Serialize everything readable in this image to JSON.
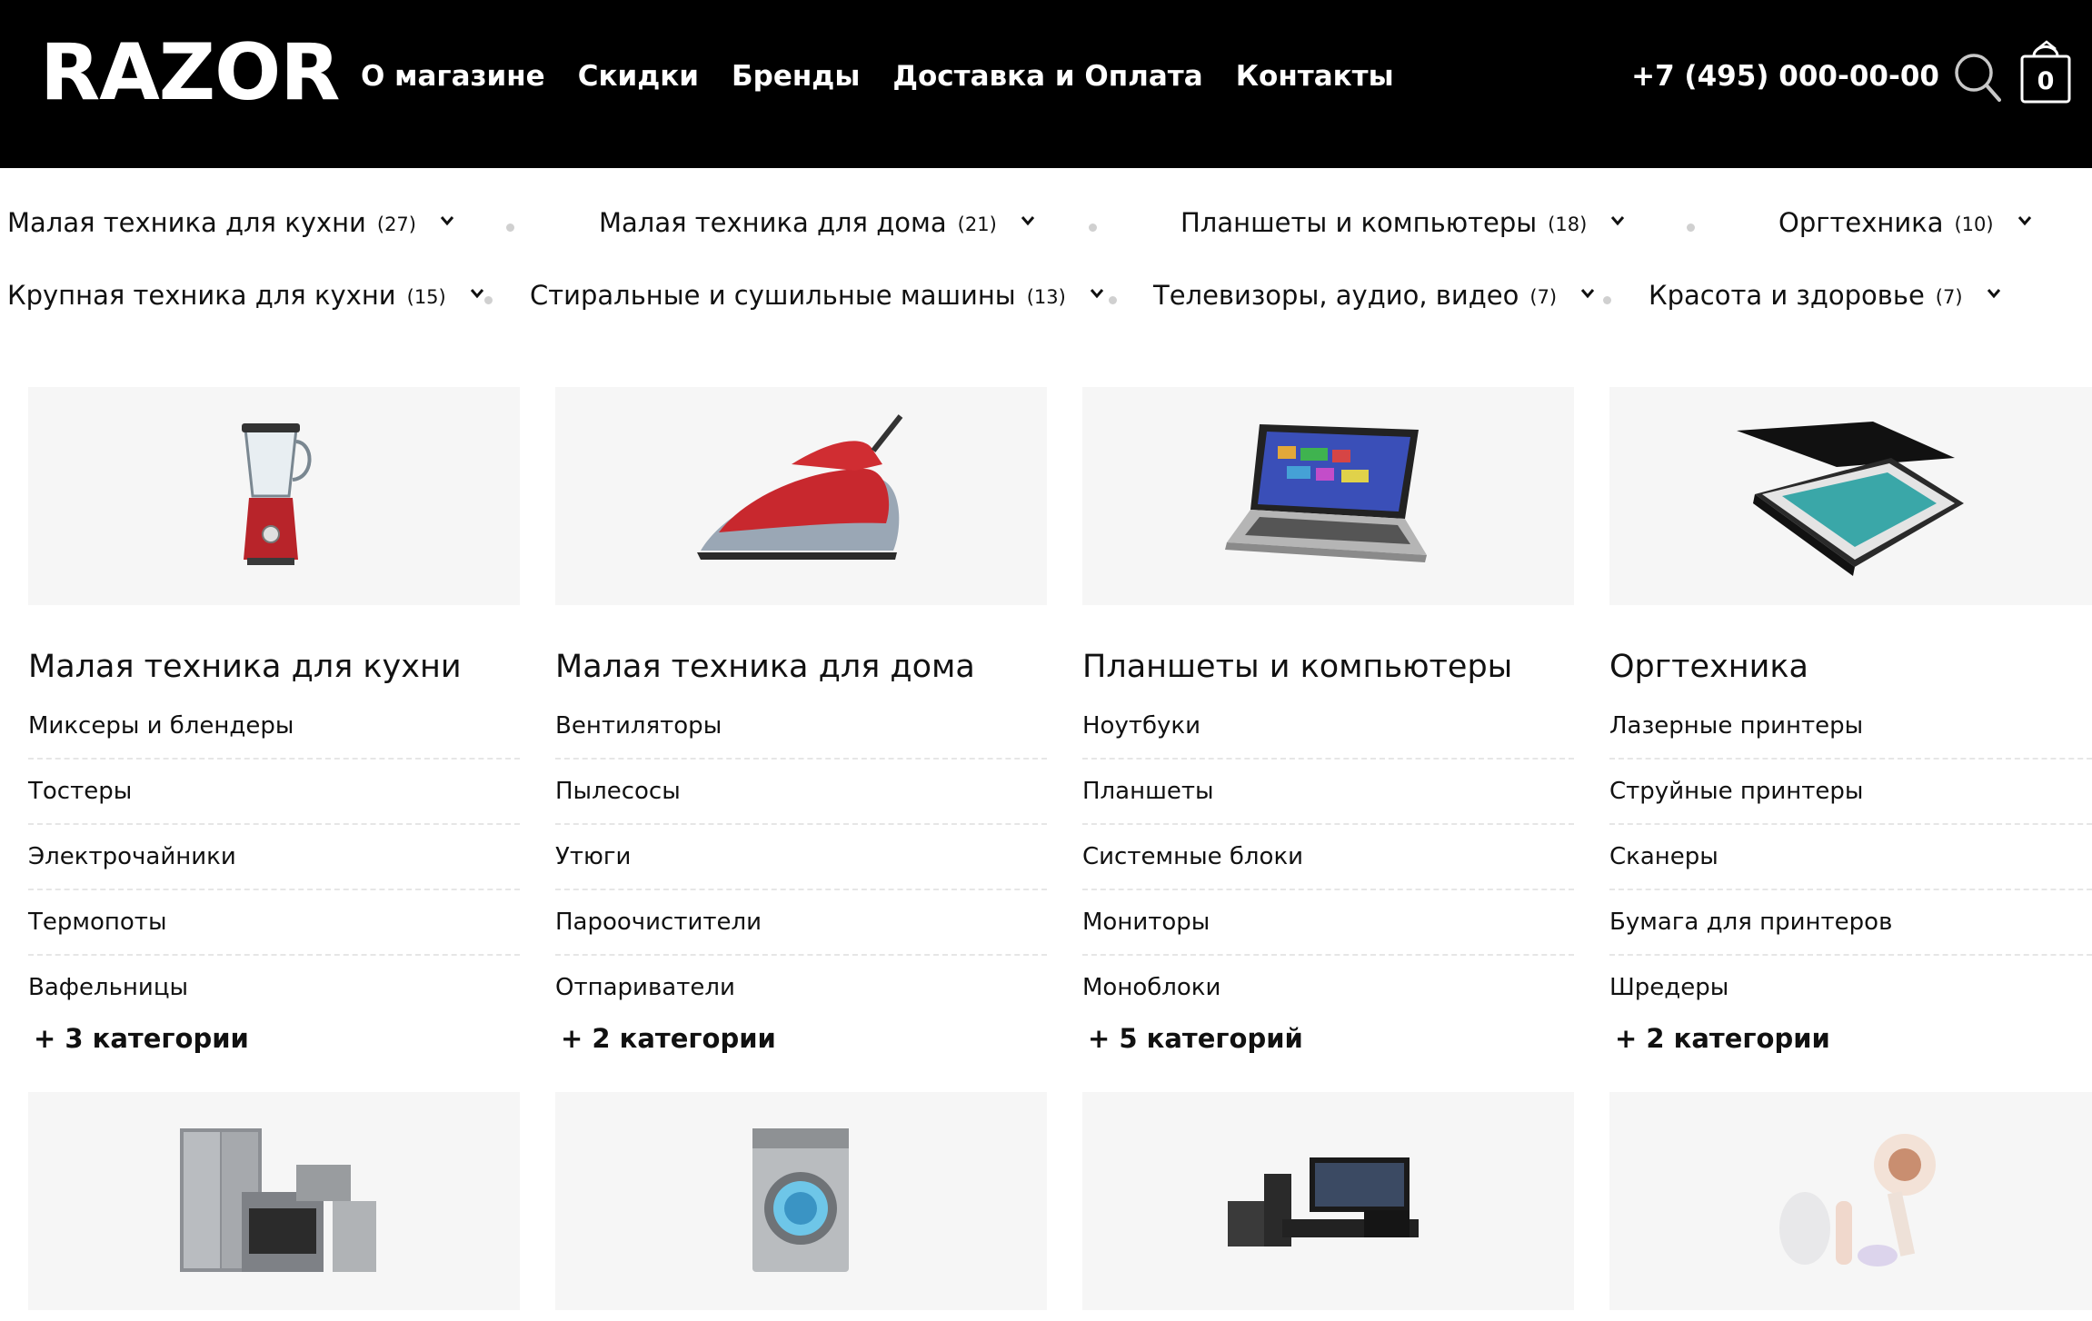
{
  "header": {
    "logo": "RAZOR",
    "nav": [
      "О магазине",
      "Скидки",
      "Бренды",
      "Доставка и Оплата",
      "Контакты"
    ],
    "phone": "+7 (495) 000-00-00",
    "cart_count": "0"
  },
  "filters": [
    {
      "label": "Малая техника для кухни",
      "count": "(27)"
    },
    {
      "label": "Малая техника для дома",
      "count": "(21)"
    },
    {
      "label": "Планшеты и компьютеры",
      "count": "(18)"
    },
    {
      "label": "Оргтехника",
      "count": "(10)"
    },
    {
      "label": "Крупная техника для кухни",
      "count": "(15)"
    },
    {
      "label": "Стиральные и сушильные машины",
      "count": "(13)"
    },
    {
      "label": "Телевизоры, аудио, видео",
      "count": "(7)"
    },
    {
      "label": "Красота и здоровье",
      "count": "(7)"
    }
  ],
  "cards": [
    {
      "title": "Малая техника для кухни",
      "items": [
        "Миксеры и блендеры",
        "Тостеры",
        "Электрочайники",
        "Термопоты",
        "Вафельницы"
      ],
      "more": "+ 3 категории",
      "image": "blender-icon"
    },
    {
      "title": "Малая техника для дома",
      "items": [
        "Вентиляторы",
        "Пылесосы",
        "Утюги",
        "Пароочистители",
        "Отпариватели"
      ],
      "more": "+ 2 категории",
      "image": "iron-icon"
    },
    {
      "title": "Планшеты и компьютеры",
      "items": [
        "Ноутбуки",
        "Планшеты",
        "Системные блоки",
        "Мониторы",
        "Моноблоки"
      ],
      "more": "+ 5 категорий",
      "image": "laptop-icon"
    },
    {
      "title": "Оргтехника",
      "items": [
        "Лазерные принтеры",
        "Струйные принтеры",
        "Сканеры",
        "Бумага для принтеров",
        "Шредеры"
      ],
      "more": "+ 2 категории",
      "image": "scanner-icon"
    },
    {
      "image": "kitchen-appliances-icon"
    },
    {
      "image": "washing-machine-icon"
    },
    {
      "image": "audio-video-icon"
    },
    {
      "image": "hair-dryer-icon"
    }
  ],
  "colors": {
    "header_bg": "#000000",
    "card_bg": "#f6f6f6",
    "accent_red": "#c0282d"
  }
}
